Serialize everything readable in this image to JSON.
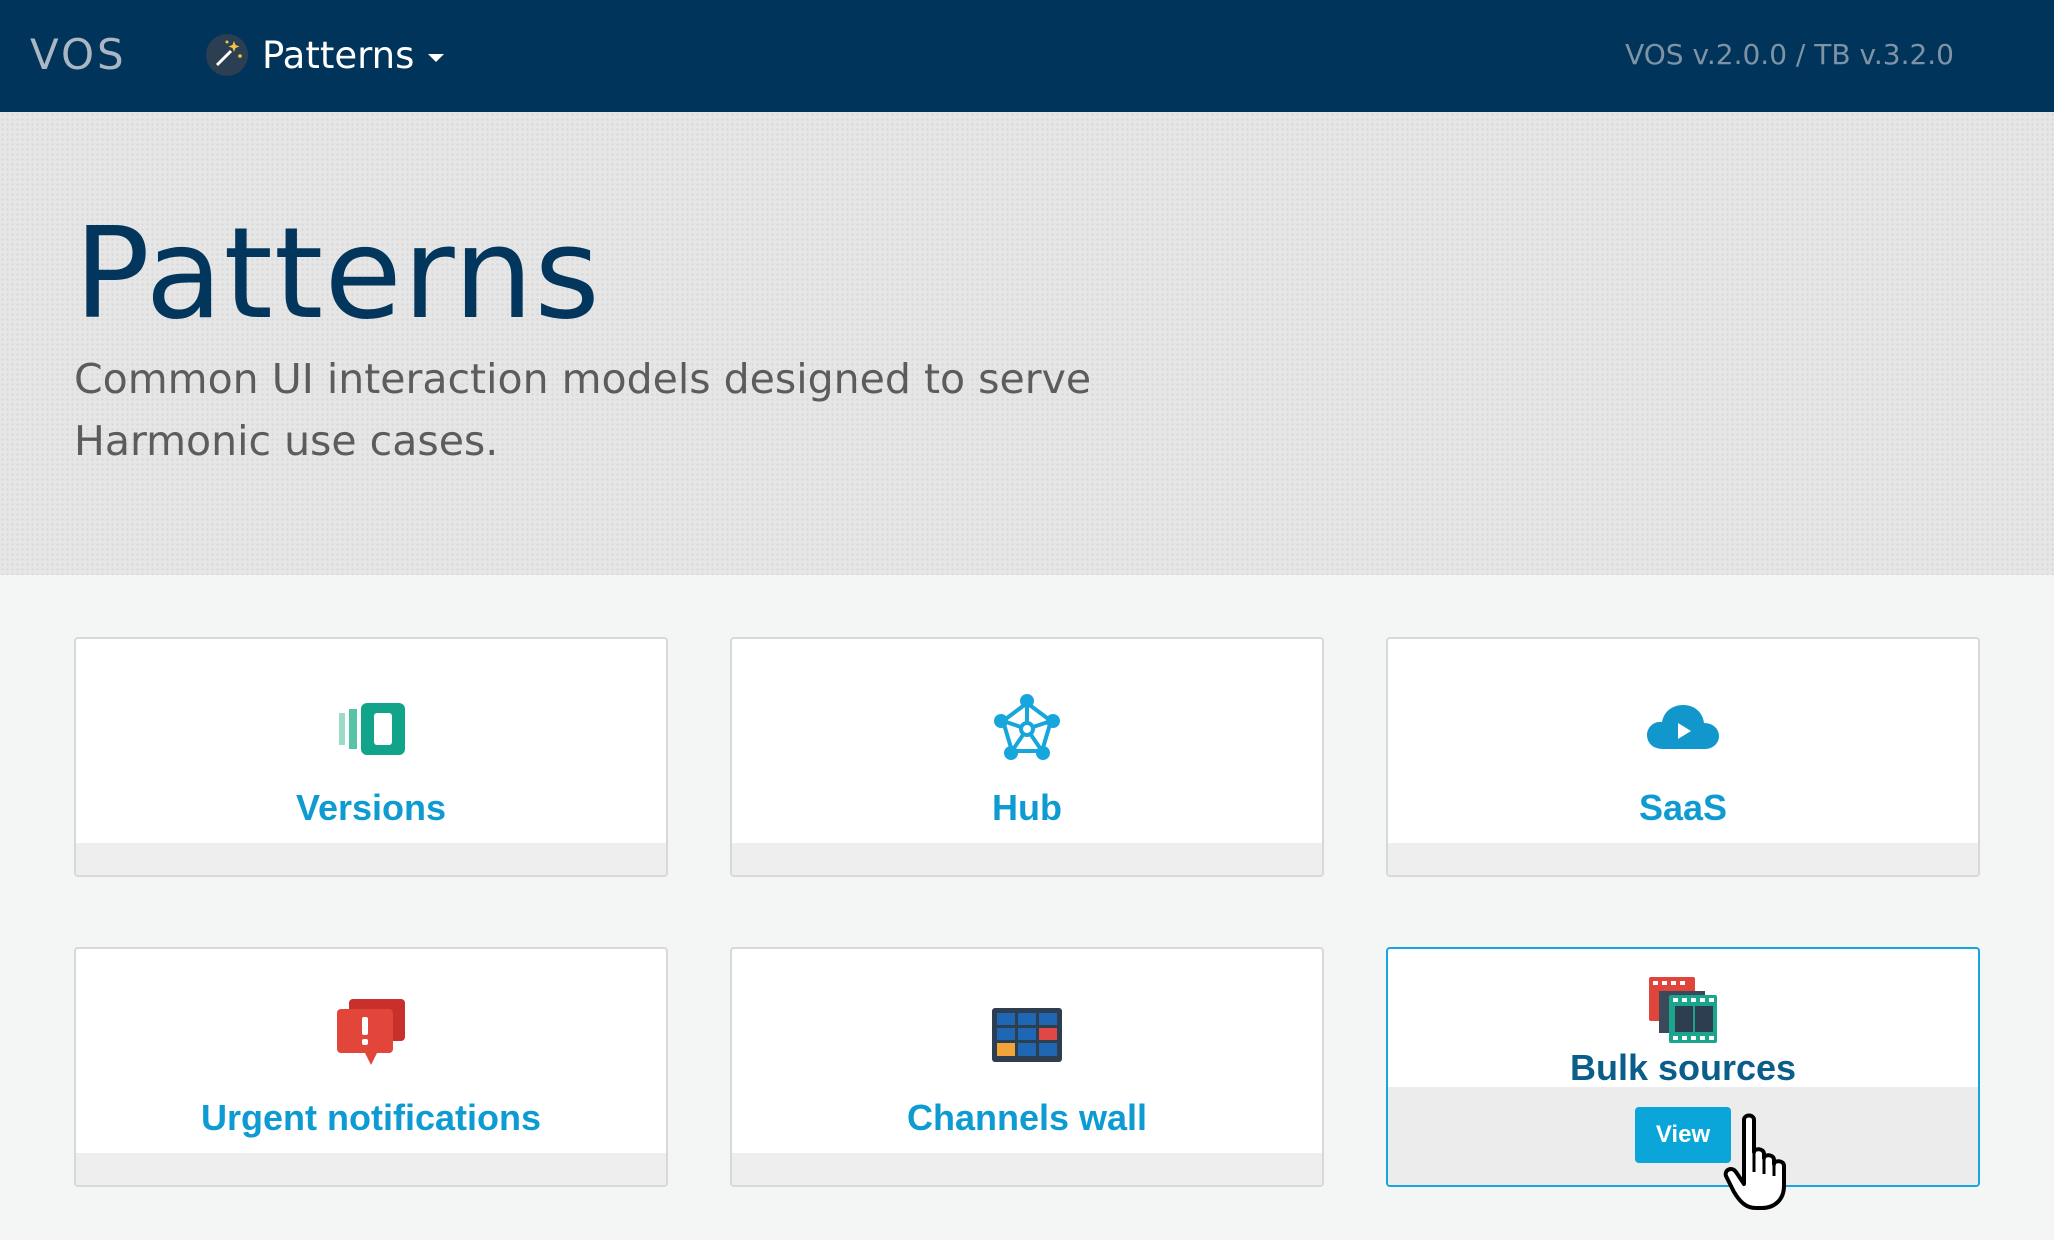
{
  "topbar": {
    "logo": "VOS",
    "nav_label": "Patterns",
    "version": "VOS v.2.0.0 / TB v.3.2.0"
  },
  "hero": {
    "title": "Patterns",
    "subtitle": "Common UI interaction models designed to serve Harmonic use cases."
  },
  "cards": [
    {
      "title": "Versions",
      "icon": "versions-icon",
      "color": "#12a48a"
    },
    {
      "title": "Hub",
      "icon": "hub-icon",
      "color": "#16a6db"
    },
    {
      "title": "SaaS",
      "icon": "cloud-play-icon",
      "color": "#1197cc"
    },
    {
      "title": "Urgent notifications",
      "icon": "urgent-notification-icon",
      "color": "#e2463a"
    },
    {
      "title": "Channels wall",
      "icon": "channels-wall-icon",
      "color": "#1f67b3"
    },
    {
      "title": "Bulk sources",
      "icon": "bulk-sources-icon",
      "color": "#e0453b",
      "button": "View"
    }
  ],
  "colors": {
    "topbar": "#01345a",
    "accent": "#0d9bd2",
    "title_dark": "#03365c"
  }
}
